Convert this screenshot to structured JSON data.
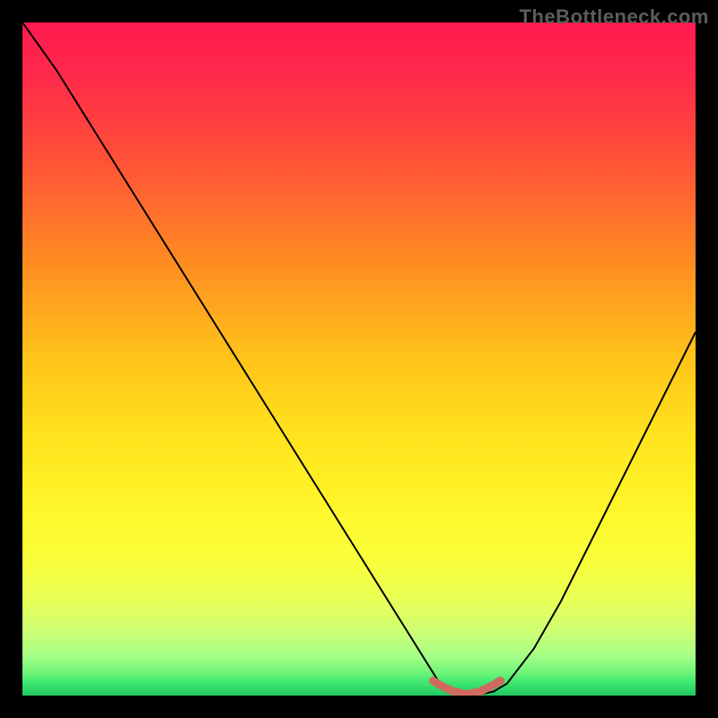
{
  "watermark": "TheBottleneck.com",
  "chart_data": {
    "type": "line",
    "title": "",
    "xlabel": "",
    "ylabel": "",
    "xlim": [
      0,
      100
    ],
    "ylim": [
      0,
      100
    ],
    "series": [
      {
        "name": "bottleneck-curve",
        "x": [
          0,
          5,
          10,
          15,
          20,
          25,
          30,
          35,
          40,
          45,
          50,
          55,
          60,
          62,
          64,
          66,
          68,
          70,
          72,
          76,
          80,
          84,
          88,
          92,
          96,
          100
        ],
        "y": [
          100,
          93,
          85,
          77,
          69,
          61,
          53,
          45,
          37,
          29,
          21,
          13,
          5,
          1.8,
          0.6,
          0.2,
          0.2,
          0.6,
          1.8,
          7,
          14,
          22,
          30,
          38,
          46,
          54
        ]
      }
    ],
    "highlight": {
      "name": "optimal-zone",
      "x": [
        61,
        62,
        64,
        66,
        68,
        70,
        71
      ],
      "y": [
        2.2,
        1.6,
        0.6,
        0.2,
        0.6,
        1.6,
        2.2
      ]
    },
    "gradient_stops": [
      {
        "offset": 0.0,
        "color": "#ff1a4f"
      },
      {
        "offset": 0.08,
        "color": "#ff2a4a"
      },
      {
        "offset": 0.2,
        "color": "#ff5038"
      },
      {
        "offset": 0.35,
        "color": "#ff8a22"
      },
      {
        "offset": 0.5,
        "color": "#ffc41a"
      },
      {
        "offset": 0.62,
        "color": "#ffe41e"
      },
      {
        "offset": 0.72,
        "color": "#fff62a"
      },
      {
        "offset": 0.8,
        "color": "#f9ff3a"
      },
      {
        "offset": 0.86,
        "color": "#e8ff58"
      },
      {
        "offset": 0.9,
        "color": "#d0ff70"
      },
      {
        "offset": 0.94,
        "color": "#a8ff86"
      },
      {
        "offset": 0.965,
        "color": "#70f67a"
      },
      {
        "offset": 0.982,
        "color": "#3ce66e"
      },
      {
        "offset": 1.0,
        "color": "#22c760"
      }
    ]
  }
}
